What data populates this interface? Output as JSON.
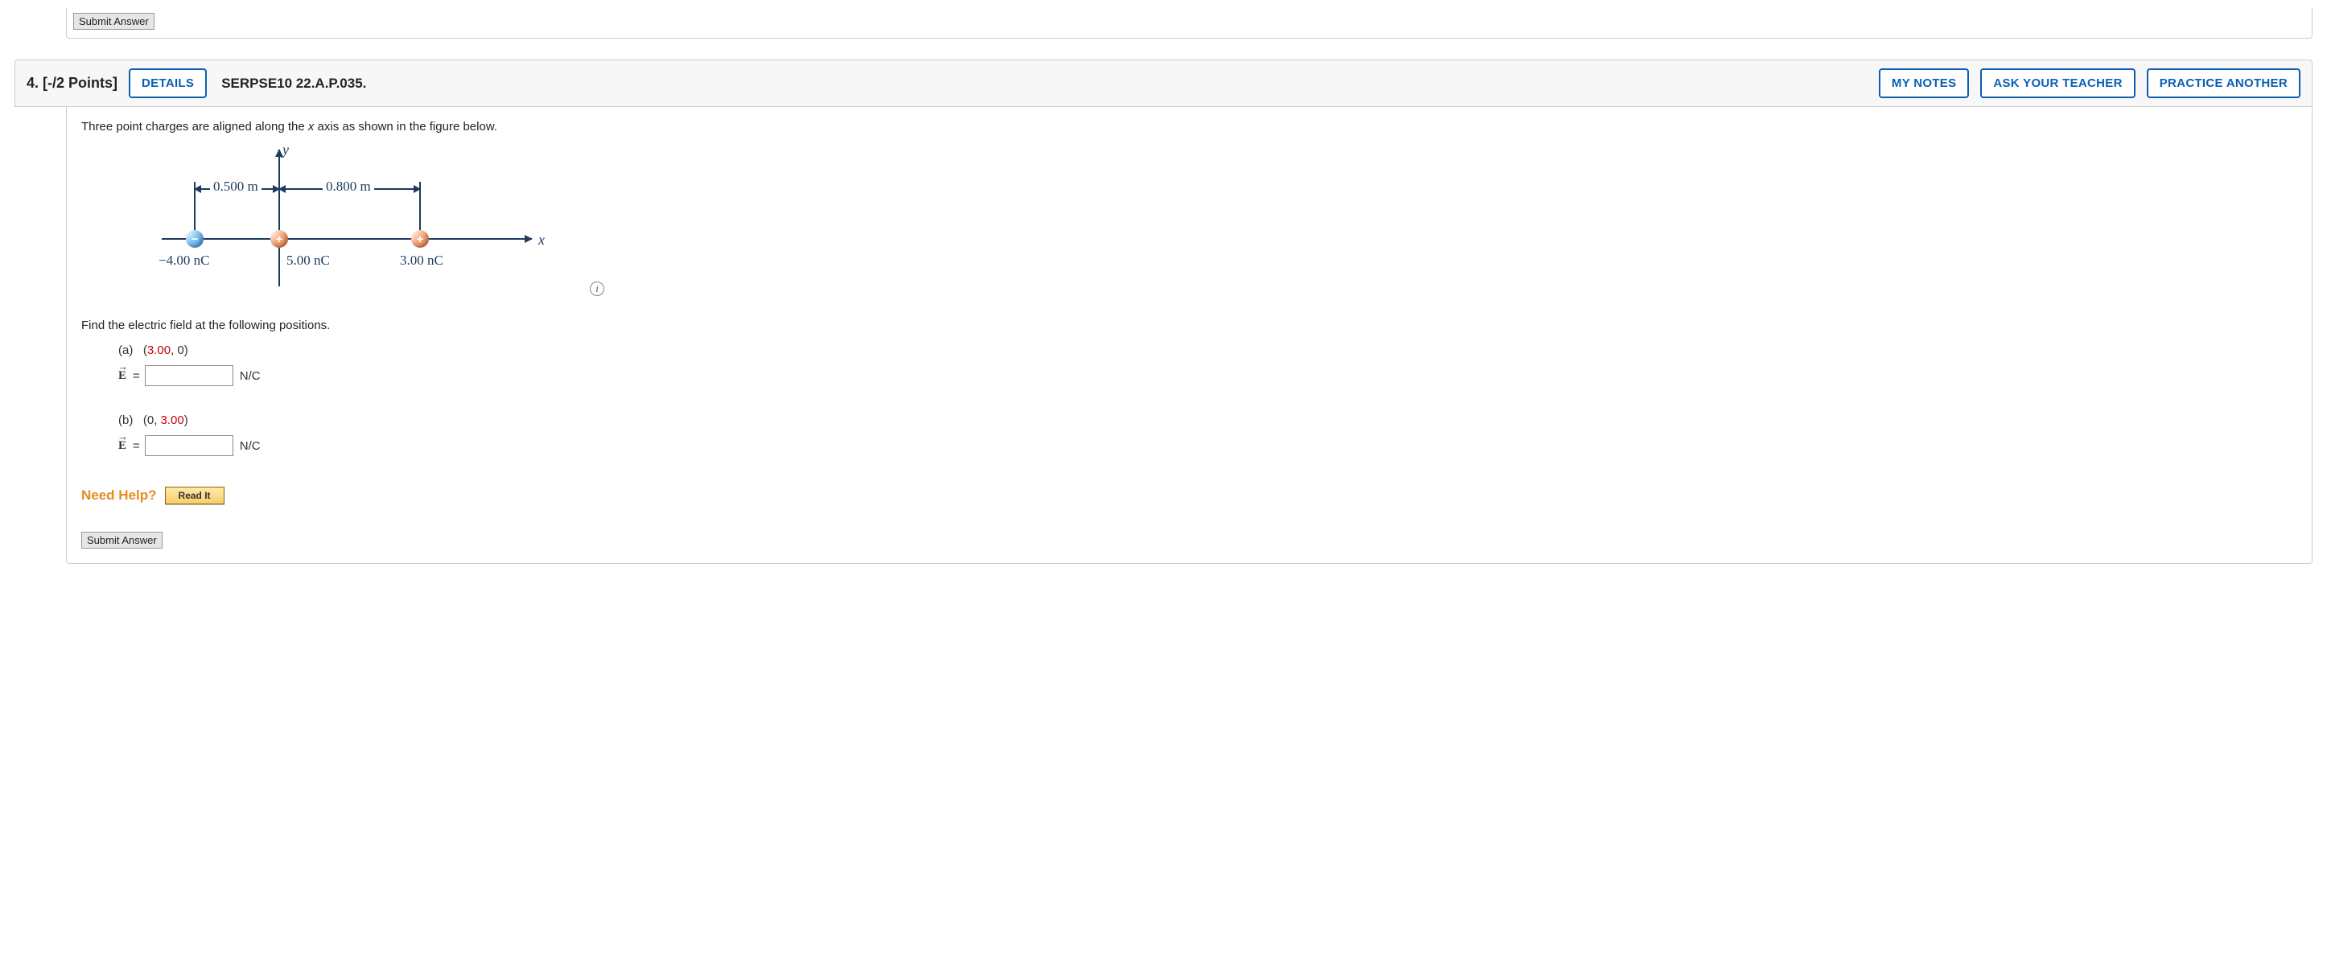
{
  "top_submit": {
    "label": "Submit Answer"
  },
  "question": {
    "number": "4.",
    "points": "[-/2 Points]",
    "details_btn": "DETAILS",
    "source": "SERPSE10 22.A.P.035.",
    "my_notes_btn": "MY NOTES",
    "ask_teacher_btn": "ASK YOUR TEACHER",
    "practice_btn": "PRACTICE ANOTHER",
    "intro_pre": "Three point charges are aligned along the ",
    "intro_var": "x",
    "intro_post": " axis as shown in the figure below.",
    "figure": {
      "y_axis": "y",
      "x_axis": "x",
      "dist1": "0.500 m",
      "dist2": "0.800 m",
      "charge1": "−4.00 nC",
      "charge1_sign": "−",
      "charge2": "5.00 nC",
      "charge2_sign": "+",
      "charge3": "3.00 nC",
      "charge3_sign": "+",
      "info": "i"
    },
    "prompt2": "Find the electric field at the following positions.",
    "parts": {
      "a": {
        "label": "(a)",
        "coord_open": "(",
        "coord_x": "3.00",
        "coord_sep": ", 0)",
        "units": "N/C"
      },
      "b": {
        "label": "(b)",
        "coord_open": "(0, ",
        "coord_y": "3.00",
        "coord_close": ")",
        "units": "N/C"
      }
    },
    "evec": "E",
    "equals": " = ",
    "need_help": "Need Help?",
    "read_it": "Read It",
    "submit": "Submit Answer"
  }
}
